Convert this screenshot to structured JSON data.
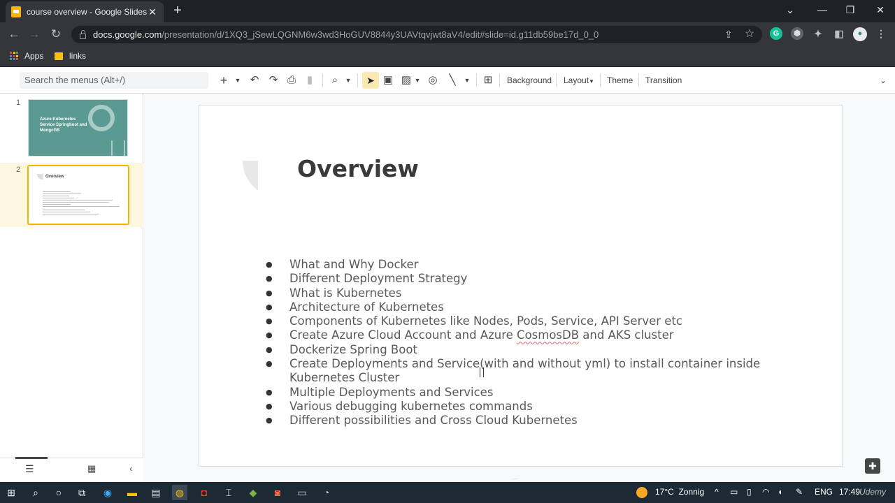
{
  "browser": {
    "tab_title": "course overview - Google Slides",
    "tab_close": "✕",
    "new_tab": "+",
    "window_controls": [
      "⌄",
      "—",
      "❐",
      "✕"
    ],
    "url_host": "docs.google.com",
    "url_path": "/presentation/d/1XQ3_jSewLQGNM6w3wd3HoGUV8844y3UAVtqvjwt8aV4/edit#slide=id.g11db59be17d_0_0",
    "bookmarks": [
      {
        "label": "Apps",
        "icon": "apps-grid-icon"
      },
      {
        "label": "links",
        "icon": "folder-icon"
      }
    ]
  },
  "slides_toolbar": {
    "search_placeholder": "Search the menus (Alt+/)",
    "background_label": "Background",
    "layout_label": "Layout",
    "theme_label": "Theme",
    "transition_label": "Transition"
  },
  "filmstrip": {
    "slides": [
      {
        "number": "1",
        "title": "Azure Kubernetes Service Springboot and MongoDB"
      },
      {
        "number": "2",
        "title": "Overview"
      }
    ]
  },
  "slide": {
    "title": "Overview",
    "bullets": [
      "What and Why Docker",
      "Different Deployment Strategy",
      "What is Kubernetes",
      "Architecture of Kubernetes",
      "Components of Kubernetes like Nodes, Pods, Service, API Server etc",
      "Create Azure Cloud Account and Azure CosmosDB and AKS cluster",
      "Dockerize Spring Boot",
      "Create Deployments and Service(with and without yml) to install container inside Kubernetes Cluster",
      "Multiple Deployments and Services",
      "Various debugging kubernetes commands",
      "Different possibilities and Cross Cloud Kubernetes"
    ]
  },
  "taskbar": {
    "weather": "17°C  Zonnig",
    "language": "ENG",
    "time": "17:49",
    "watermark": "Udemy"
  },
  "colors": {
    "accent_selected": "#f4b400",
    "thumb1_bg": "#5b9a93"
  }
}
